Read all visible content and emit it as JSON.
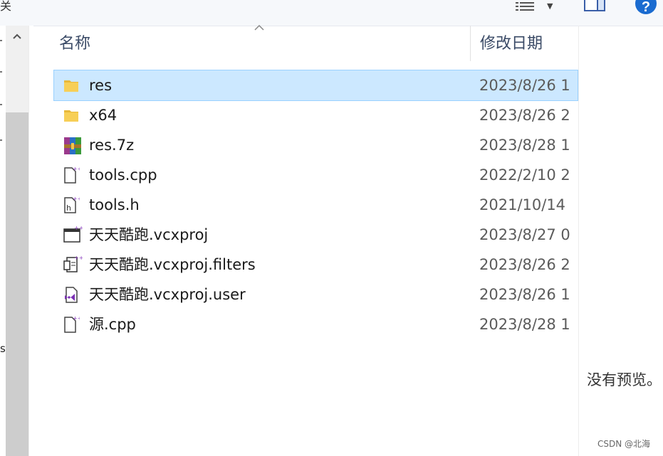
{
  "toolbar": {
    "cut_title_fragment": "关",
    "view_dropdown_glyph": "▼",
    "help_glyph": "?"
  },
  "nav": {
    "cut_fragment": "s"
  },
  "columns": {
    "name": "名称",
    "modified": "修改日期"
  },
  "files": [
    {
      "name": "res",
      "date": "2023/8/26 1",
      "icon": "folder-icon",
      "selected": true
    },
    {
      "name": "x64",
      "date": "2023/8/26 2",
      "icon": "folder-icon",
      "selected": false
    },
    {
      "name": "res.7z",
      "date": "2023/8/28 1",
      "icon": "archive-icon",
      "selected": false
    },
    {
      "name": "tools.cpp",
      "date": "2022/2/10 2",
      "icon": "cpp-file-icon",
      "selected": false
    },
    {
      "name": "tools.h",
      "date": "2021/10/14",
      "icon": "header-file-icon",
      "selected": false
    },
    {
      "name": "天天酷跑.vcxproj",
      "date": "2023/8/27 0",
      "icon": "vcxproj-icon",
      "selected": false
    },
    {
      "name": "天天酷跑.vcxproj.filters",
      "date": "2023/8/26 2",
      "icon": "filters-file-icon",
      "selected": false
    },
    {
      "name": "天天酷跑.vcxproj.user",
      "date": "2023/8/26 1",
      "icon": "vs-user-file-icon",
      "selected": false
    },
    {
      "name": "源.cpp",
      "date": "2023/8/28 1",
      "icon": "cpp-file-icon",
      "selected": false
    }
  ],
  "preview": {
    "empty_text": "没有预览。"
  },
  "watermark": "CSDN @北海",
  "colors": {
    "selection": "#cce8ff",
    "selection_border": "#99d1ff",
    "header_text": "#3a4a66",
    "help_button": "#1a6bd0"
  }
}
